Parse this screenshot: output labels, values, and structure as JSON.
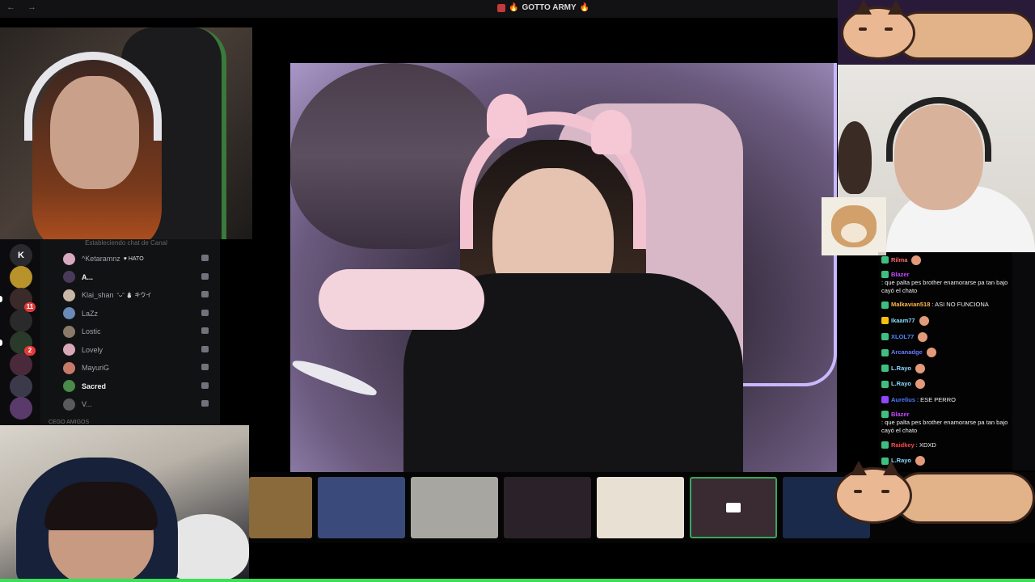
{
  "window": {
    "nav": "← →",
    "title": "GOTTO ARMY",
    "title_icon": "fire-emoji"
  },
  "colors": {
    "accent_green": "#3adf5a",
    "discord_bg": "#111214",
    "ping_red": "#e23a3a",
    "twitch_purple": "#9146ff"
  },
  "sidebar": {
    "header": "Estableciendo chat de Canal",
    "servers": [
      {
        "label": "K",
        "ping": ""
      },
      {
        "label": "",
        "ping": ""
      },
      {
        "label": "",
        "ping": "11"
      },
      {
        "label": "",
        "ping": ""
      },
      {
        "label": "",
        "ping": "2"
      },
      {
        "label": "",
        "ping": ""
      },
      {
        "label": "",
        "ping": ""
      },
      {
        "label": "",
        "ping": ""
      }
    ],
    "voice_users": [
      {
        "name": "^Ketaramnz",
        "tag": "♥ HATO",
        "bright": false,
        "avatar": "#d8a8c0"
      },
      {
        "name": "A...",
        "tag": "",
        "bright": true,
        "avatar": "#4a3a5a"
      },
      {
        "name": "Klai_shan",
        "tag": "ᵔᴗᵔ ⛄ キウイ",
        "bright": false,
        "avatar": "#c8b8a8"
      },
      {
        "name": "LaZz",
        "tag": "",
        "bright": false,
        "avatar": "#6a8ab8"
      },
      {
        "name": "Lostic",
        "tag": "",
        "bright": false,
        "avatar": "#8a7a6a"
      },
      {
        "name": "Lovely",
        "tag": "",
        "bright": false,
        "avatar": "#d8a8b8"
      },
      {
        "name": "MayuriG",
        "tag": "",
        "bright": false,
        "avatar": "#c87a6a"
      },
      {
        "name": "Sacred",
        "tag": "",
        "bright": true,
        "avatar": "#4a8a4a"
      },
      {
        "name": "V...",
        "tag": "",
        "bright": false,
        "avatar": "#5a5a5a"
      }
    ],
    "footer": "CEGO AMIGOS"
  },
  "chat": [
    {
      "user": "Rilma",
      "text": "",
      "badge": "green",
      "color": "#ff6a6a"
    },
    {
      "user": "Blazer",
      "text": ": que palta pes brother enamorarse pa tan bajo cayó el chato",
      "badge": "green",
      "color": "#c84aff"
    },
    {
      "user": "Malkavian518",
      "text": ": ASI NO FUNCIONA",
      "badge": "green",
      "color": "#ffb84a"
    },
    {
      "user": "Ikaam77",
      "text": "",
      "badge": "yellow",
      "color": "#8ad8ff"
    },
    {
      "user": "XLOL77",
      "text": "",
      "badge": "green",
      "color": "#4a8aff"
    },
    {
      "user": "Arcanadge",
      "text": "",
      "badge": "green",
      "color": "#6a7aff"
    },
    {
      "user": "L.Rayo",
      "text": "",
      "badge": "green",
      "color": "#8ad8ff"
    },
    {
      "user": "L.Rayo",
      "text": "",
      "badge": "green",
      "color": "#8ad8ff"
    },
    {
      "user": "Aurelius",
      "text": ": ESE PERRO",
      "badge": "purple",
      "color": "#4a7aff"
    },
    {
      "user": "Blazer",
      "text": ": que palta pes brother enamorarse pa tan bajo cayó el chato",
      "badge": "green",
      "color": "#c84aff"
    },
    {
      "user": "Raidkey",
      "text": ": XDXD",
      "badge": "green",
      "color": "#ff4a4a"
    },
    {
      "user": "L.Rayo",
      "text": "",
      "badge": "green",
      "color": "#8ad8ff"
    }
  ],
  "thumbnails": [
    {
      "name": "thumb-1",
      "bg": "#8a6a3a",
      "active": false,
      "cam_off": false
    },
    {
      "name": "thumb-2",
      "bg": "#3a4a7a",
      "active": false,
      "cam_off": false
    },
    {
      "name": "thumb-3",
      "bg": "#a8a6a0",
      "active": false,
      "cam_off": false
    },
    {
      "name": "thumb-4",
      "bg": "#2a2228",
      "active": false,
      "cam_off": false
    },
    {
      "name": "thumb-5",
      "bg": "#e8e0d2",
      "active": false,
      "cam_off": false
    },
    {
      "name": "thumb-6",
      "bg": "#3a2a32",
      "active": true,
      "cam_off": true
    },
    {
      "name": "thumb-7",
      "bg": "#1a2a4a",
      "active": false,
      "cam_off": false
    }
  ]
}
